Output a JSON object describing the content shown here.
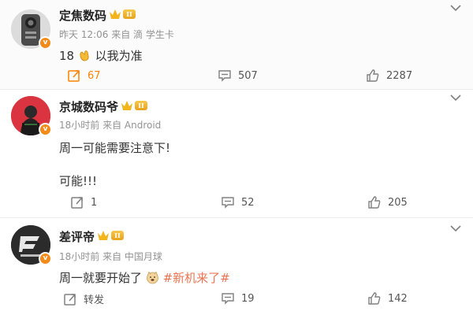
{
  "posts": [
    {
      "username": "定焦数码",
      "level": "II",
      "meta": "昨天 12:06  来自 滴 学生卡",
      "lines": [
        "18"
      ],
      "text_suffix": "以我为准",
      "emoji": "clap-hands",
      "repost": "67",
      "comments": "507",
      "likes": "2287",
      "repost_highlight": true
    },
    {
      "username": "京城数码爷",
      "level": "II",
      "meta": "18小时前  来自 Android",
      "lines": [
        "周一可能需要注意下!",
        "可能!!!"
      ],
      "repost": "1",
      "comments": "52",
      "likes": "205"
    },
    {
      "username": "差评帝",
      "level": "II",
      "meta": "18小时前  来自 中国月球",
      "text": "周一就要开始了",
      "emoji": "doge-face",
      "topic": "#新机来了#",
      "repost": "转发",
      "comments": "19",
      "likes": "142"
    }
  ],
  "colors": {
    "accent": "#ff8200",
    "topic": "#eb7350",
    "verified": "#f28b1a",
    "meta": "#939393"
  }
}
